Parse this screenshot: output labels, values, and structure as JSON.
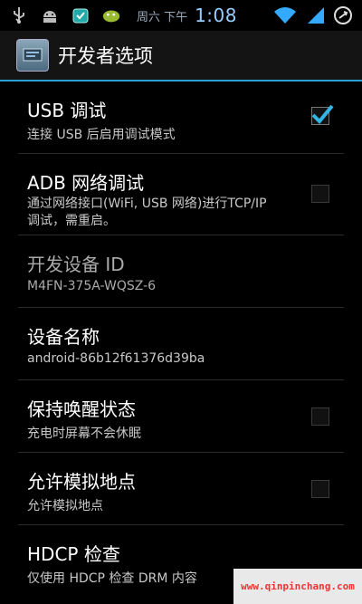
{
  "status_bar": {
    "date": "周六 下午",
    "time": "1:08",
    "icons_left": [
      "usb-icon",
      "android-debug-icon",
      "app-store-icon",
      "android-icon"
    ],
    "icons_right": [
      "wifi-icon",
      "signal-icon",
      "sync-icon"
    ]
  },
  "action_bar": {
    "title": "开发者选项",
    "icon": "settings-icon"
  },
  "items": [
    {
      "title": "USB 调试",
      "summary": "连接 USB 后启用调试模式",
      "checked": true
    },
    {
      "title": "ADB 网络调试",
      "summary": "通过网络接口(WiFi, USB 网络)进行TCP/IP 调试，需重启。",
      "checked": false
    },
    {
      "title": "开发设备 ID",
      "summary": "M4FN-375A-WQSZ-6"
    },
    {
      "title": "设备名称",
      "summary": "android-86b12f61376d39ba"
    },
    {
      "title": "保持唤醒状态",
      "summary": "充电时屏幕不会休眠",
      "checked": false
    },
    {
      "title": "允许模拟地点",
      "summary": "允许模拟地点",
      "checked": false
    },
    {
      "title": "HDCP 检查",
      "summary": "仅使用 HDCP 检查 DRM 内容"
    }
  ],
  "watermark": "www.qinpinchang.com",
  "colors": {
    "accent": "#2a9fd6",
    "check": "#33b5e5"
  }
}
